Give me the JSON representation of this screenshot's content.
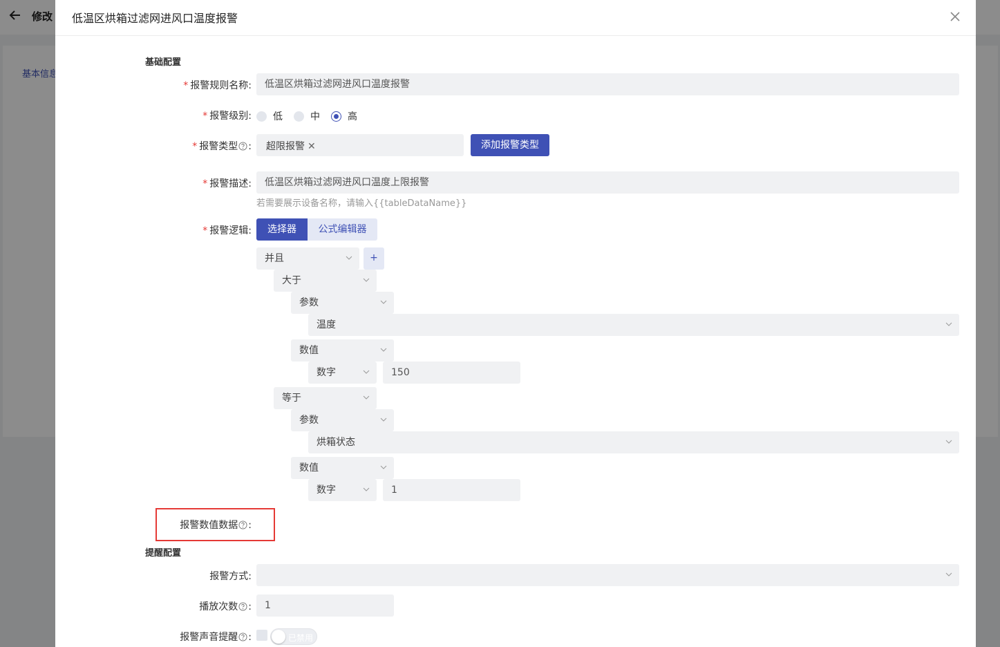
{
  "background": {
    "back_icon": "arrow-left-icon",
    "title": "修改",
    "tab_link": "基本信息"
  },
  "modal": {
    "title": "低温区烘箱过滤网进风口温度报警",
    "close_icon": "close-icon"
  },
  "basic_section": {
    "title": "基础配置",
    "rule_name": {
      "label": "报警规则名称:",
      "value": "低温区烘箱过滤网进风口温度报警"
    },
    "level": {
      "label": "报警级别:",
      "options": [
        "低",
        "中",
        "高"
      ],
      "selected": "高"
    },
    "type": {
      "label": "报警类型",
      "colon": ":",
      "tag": "超限报警",
      "add_button": "添加报警类型"
    },
    "description": {
      "label": "报警描述:",
      "value": "低温区烘箱过滤网进风口温度上限报警",
      "hint": "若需要展示设备名称，请输入{{tableDataName}}"
    },
    "logic": {
      "label": "报警逻辑:",
      "mode_selector": "选择器",
      "mode_formula": "公式编辑器",
      "active_mode": "选择器",
      "root_operator": "并且",
      "add_button": "+",
      "conditions": [
        {
          "operator": "大于",
          "left_type": "参数",
          "left_value": "温度",
          "right_type": "数值",
          "right_subtype": "数字",
          "right_value": "150"
        },
        {
          "operator": "等于",
          "left_type": "参数",
          "left_value": "烘箱状态",
          "right_type": "数值",
          "right_subtype": "数字",
          "right_value": "1"
        }
      ]
    },
    "value_data": {
      "label": "报警数值数据",
      "colon": ":"
    }
  },
  "remind_section": {
    "title": "提醒配置",
    "method": {
      "label": "报警方式:",
      "value": ""
    },
    "play_count": {
      "label": "播放次数",
      "colon": ":",
      "value": "1"
    },
    "sound": {
      "label": "报警声音提醒",
      "colon": ":",
      "toggle_text": "已禁用"
    }
  },
  "colors": {
    "primary": "#3f51b5",
    "required": "#e53935",
    "input_bg": "#f0f1f3",
    "highlight_border": "#e53935"
  }
}
